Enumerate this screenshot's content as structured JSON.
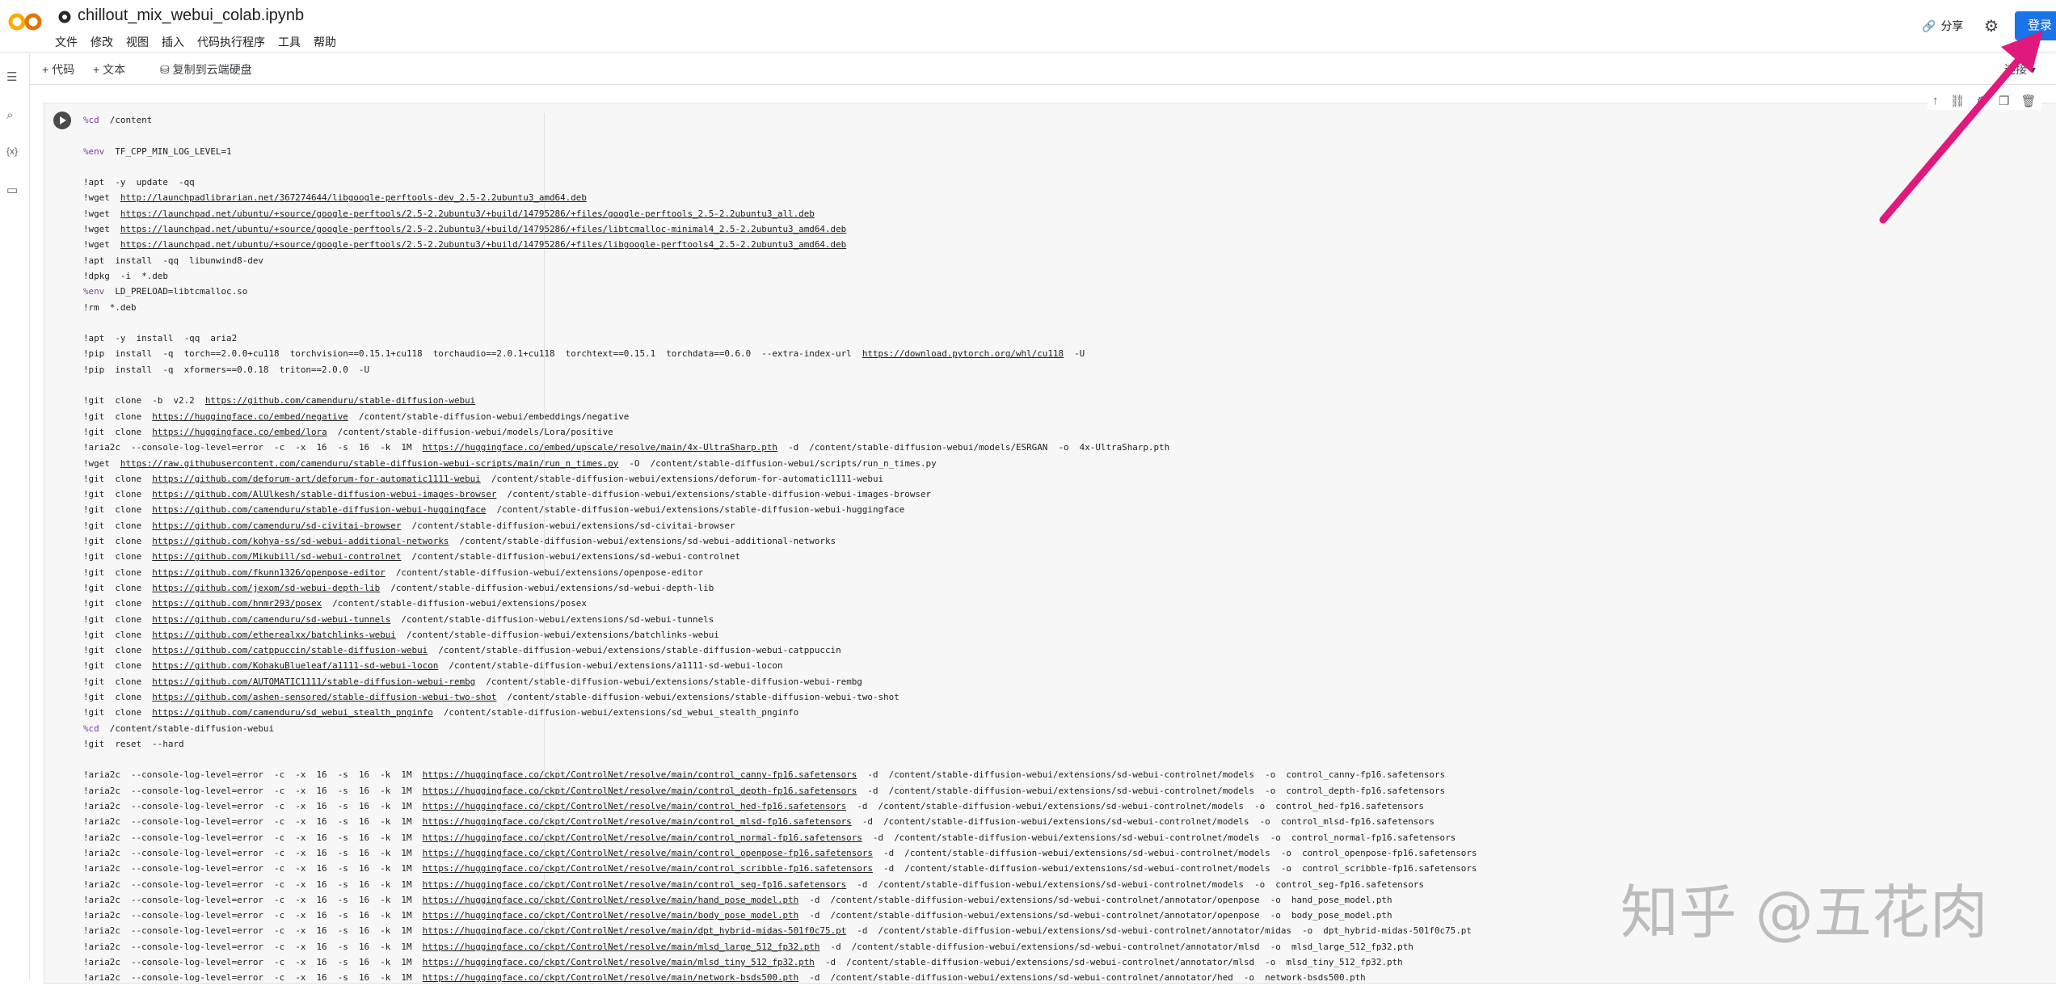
{
  "header": {
    "title": "chillout_mix_webui_colab.ipynb",
    "menu": [
      "文件",
      "修改",
      "视图",
      "插入",
      "代码执行程序",
      "工具",
      "帮助"
    ],
    "share_label": "分享",
    "login_label": "登录"
  },
  "toolbar": {
    "add_code": "+ 代码",
    "add_text": "+ 文本",
    "copy_drive": "复制到云端硬盘",
    "connect": "连接"
  },
  "colors": {
    "accent": "#1a73e8",
    "arrow": "#e0197d",
    "keyword": "#7b3fa0",
    "number": "#0b8043"
  },
  "watermark": "知乎 @五花肉",
  "code_lines": [
    "%cd  /content",
    "",
    "%env  TF_CPP_MIN_LOG_LEVEL=1",
    "",
    "!apt  -y  update  -qq",
    "!wget  http://launchpadlibrarian.net/367274644/libgoogle-perftools-dev_2.5-2.2ubuntu3_amd64.deb",
    "!wget  https://launchpad.net/ubuntu/+source/google-perftools/2.5-2.2ubuntu3/+build/14795286/+files/google-perftools_2.5-2.2ubuntu3_all.deb",
    "!wget  https://launchpad.net/ubuntu/+source/google-perftools/2.5-2.2ubuntu3/+build/14795286/+files/libtcmalloc-minimal4_2.5-2.2ubuntu3_amd64.deb",
    "!wget  https://launchpad.net/ubuntu/+source/google-perftools/2.5-2.2ubuntu3/+build/14795286/+files/libgoogle-perftools4_2.5-2.2ubuntu3_amd64.deb",
    "!apt  install  -qq  libunwind8-dev",
    "!dpkg  -i  *.deb",
    "%env  LD_PRELOAD=libtcmalloc.so",
    "!rm  *.deb",
    "",
    "!apt  -y  install  -qq  aria2",
    "!pip  install  -q  torch==2.0.0+cu118  torchvision==0.15.1+cu118  torchaudio==2.0.1+cu118  torchtext==0.15.1  torchdata==0.6.0  --extra-index-url  https://download.pytorch.org/whl/cu118  -U",
    "!pip  install  -q  xformers==0.0.18  triton==2.0.0  -U",
    "",
    "!git  clone  -b  v2.2  https://github.com/camenduru/stable-diffusion-webui",
    "!git  clone  https://huggingface.co/embed/negative  /content/stable-diffusion-webui/embeddings/negative",
    "!git  clone  https://huggingface.co/embed/lora  /content/stable-diffusion-webui/models/Lora/positive",
    "!aria2c  --console-log-level=error  -c  -x  16  -s  16  -k  1M  https://huggingface.co/embed/upscale/resolve/main/4x-UltraSharp.pth  -d  /content/stable-diffusion-webui/models/ESRGAN  -o  4x-UltraSharp.pth",
    "!wget  https://raw.githubusercontent.com/camenduru/stable-diffusion-webui-scripts/main/run_n_times.py  -O  /content/stable-diffusion-webui/scripts/run_n_times.py",
    "!git  clone  https://github.com/deforum-art/deforum-for-automatic1111-webui  /content/stable-diffusion-webui/extensions/deforum-for-automatic1111-webui",
    "!git  clone  https://github.com/AlUlkesh/stable-diffusion-webui-images-browser  /content/stable-diffusion-webui/extensions/stable-diffusion-webui-images-browser",
    "!git  clone  https://github.com/camenduru/stable-diffusion-webui-huggingface  /content/stable-diffusion-webui/extensions/stable-diffusion-webui-huggingface",
    "!git  clone  https://github.com/camenduru/sd-civitai-browser  /content/stable-diffusion-webui/extensions/sd-civitai-browser",
    "!git  clone  https://github.com/kohya-ss/sd-webui-additional-networks  /content/stable-diffusion-webui/extensions/sd-webui-additional-networks",
    "!git  clone  https://github.com/Mikubill/sd-webui-controlnet  /content/stable-diffusion-webui/extensions/sd-webui-controlnet",
    "!git  clone  https://github.com/fkunn1326/openpose-editor  /content/stable-diffusion-webui/extensions/openpose-editor",
    "!git  clone  https://github.com/jexom/sd-webui-depth-lib  /content/stable-diffusion-webui/extensions/sd-webui-depth-lib",
    "!git  clone  https://github.com/hnmr293/posex  /content/stable-diffusion-webui/extensions/posex",
    "!git  clone  https://github.com/camenduru/sd-webui-tunnels  /content/stable-diffusion-webui/extensions/sd-webui-tunnels",
    "!git  clone  https://github.com/etherealxx/batchlinks-webui  /content/stable-diffusion-webui/extensions/batchlinks-webui",
    "!git  clone  https://github.com/catppuccin/stable-diffusion-webui  /content/stable-diffusion-webui/extensions/stable-diffusion-webui-catppuccin",
    "!git  clone  https://github.com/KohakuBlueleaf/a1111-sd-webui-locon  /content/stable-diffusion-webui/extensions/a1111-sd-webui-locon",
    "!git  clone  https://github.com/AUTOMATIC1111/stable-diffusion-webui-rembg  /content/stable-diffusion-webui/extensions/stable-diffusion-webui-rembg",
    "!git  clone  https://github.com/ashen-sensored/stable-diffusion-webui-two-shot  /content/stable-diffusion-webui/extensions/stable-diffusion-webui-two-shot",
    "!git  clone  https://github.com/camenduru/sd_webui_stealth_pnginfo  /content/stable-diffusion-webui/extensions/sd_webui_stealth_pnginfo",
    "%cd  /content/stable-diffusion-webui",
    "!git  reset  --hard",
    "",
    "!aria2c  --console-log-level=error  -c  -x  16  -s  16  -k  1M  https://huggingface.co/ckpt/ControlNet/resolve/main/control_canny-fp16.safetensors  -d  /content/stable-diffusion-webui/extensions/sd-webui-controlnet/models  -o  control_canny-fp16.safetensors",
    "!aria2c  --console-log-level=error  -c  -x  16  -s  16  -k  1M  https://huggingface.co/ckpt/ControlNet/resolve/main/control_depth-fp16.safetensors  -d  /content/stable-diffusion-webui/extensions/sd-webui-controlnet/models  -o  control_depth-fp16.safetensors",
    "!aria2c  --console-log-level=error  -c  -x  16  -s  16  -k  1M  https://huggingface.co/ckpt/ControlNet/resolve/main/control_hed-fp16.safetensors  -d  /content/stable-diffusion-webui/extensions/sd-webui-controlnet/models  -o  control_hed-fp16.safetensors",
    "!aria2c  --console-log-level=error  -c  -x  16  -s  16  -k  1M  https://huggingface.co/ckpt/ControlNet/resolve/main/control_mlsd-fp16.safetensors  -d  /content/stable-diffusion-webui/extensions/sd-webui-controlnet/models  -o  control_mlsd-fp16.safetensors",
    "!aria2c  --console-log-level=error  -c  -x  16  -s  16  -k  1M  https://huggingface.co/ckpt/ControlNet/resolve/main/control_normal-fp16.safetensors  -d  /content/stable-diffusion-webui/extensions/sd-webui-controlnet/models  -o  control_normal-fp16.safetensors",
    "!aria2c  --console-log-level=error  -c  -x  16  -s  16  -k  1M  https://huggingface.co/ckpt/ControlNet/resolve/main/control_openpose-fp16.safetensors  -d  /content/stable-diffusion-webui/extensions/sd-webui-controlnet/models  -o  control_openpose-fp16.safetensors",
    "!aria2c  --console-log-level=error  -c  -x  16  -s  16  -k  1M  https://huggingface.co/ckpt/ControlNet/resolve/main/control_scribble-fp16.safetensors  -d  /content/stable-diffusion-webui/extensions/sd-webui-controlnet/models  -o  control_scribble-fp16.safetensors",
    "!aria2c  --console-log-level=error  -c  -x  16  -s  16  -k  1M  https://huggingface.co/ckpt/ControlNet/resolve/main/control_seg-fp16.safetensors  -d  /content/stable-diffusion-webui/extensions/sd-webui-controlnet/models  -o  control_seg-fp16.safetensors",
    "!aria2c  --console-log-level=error  -c  -x  16  -s  16  -k  1M  https://huggingface.co/ckpt/ControlNet/resolve/main/hand_pose_model.pth  -d  /content/stable-diffusion-webui/extensions/sd-webui-controlnet/annotator/openpose  -o  hand_pose_model.pth",
    "!aria2c  --console-log-level=error  -c  -x  16  -s  16  -k  1M  https://huggingface.co/ckpt/ControlNet/resolve/main/body_pose_model.pth  -d  /content/stable-diffusion-webui/extensions/sd-webui-controlnet/annotator/openpose  -o  body_pose_model.pth",
    "!aria2c  --console-log-level=error  -c  -x  16  -s  16  -k  1M  https://huggingface.co/ckpt/ControlNet/resolve/main/dpt_hybrid-midas-501f0c75.pt  -d  /content/stable-diffusion-webui/extensions/sd-webui-controlnet/annotator/midas  -o  dpt_hybrid-midas-501f0c75.pt",
    "!aria2c  --console-log-level=error  -c  -x  16  -s  16  -k  1M  https://huggingface.co/ckpt/ControlNet/resolve/main/mlsd_large_512_fp32.pth  -d  /content/stable-diffusion-webui/extensions/sd-webui-controlnet/annotator/mlsd  -o  mlsd_large_512_fp32.pth",
    "!aria2c  --console-log-level=error  -c  -x  16  -s  16  -k  1M  https://huggingface.co/ckpt/ControlNet/resolve/main/mlsd_tiny_512_fp32.pth  -d  /content/stable-diffusion-webui/extensions/sd-webui-controlnet/annotator/mlsd  -o  mlsd_tiny_512_fp32.pth",
    "!aria2c  --console-log-level=error  -c  -x  16  -s  16  -k  1M  https://huggingface.co/ckpt/ControlNet/resolve/main/network-bsds500.pth  -d  /content/stable-diffusion-webui/extensions/sd-webui-controlnet/annotator/hed  -o  network-bsds500.pth"
  ]
}
